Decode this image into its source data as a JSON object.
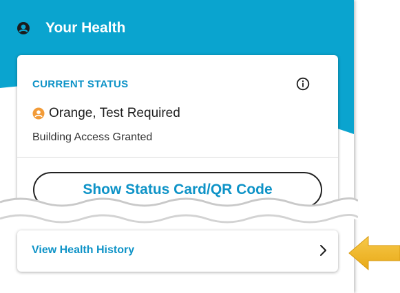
{
  "header": {
    "title": "Your Health",
    "icon": "user-circle-icon",
    "color": "#0aa4cf"
  },
  "status_card": {
    "heading": "CURRENT STATUS",
    "info_icon": "info-icon",
    "status_color_icon": "status-dot-icon",
    "status_color": "#f29b38",
    "status_text": "Orange, Test Required",
    "access_text": "Building Access Granted",
    "button_label": "Show Status Card/QR Code"
  },
  "history": {
    "label": "View Health History",
    "icon": "chevron-right-icon"
  },
  "annotation": {
    "icon": "pointer-arrow-icon",
    "color": "#f3b829"
  }
}
